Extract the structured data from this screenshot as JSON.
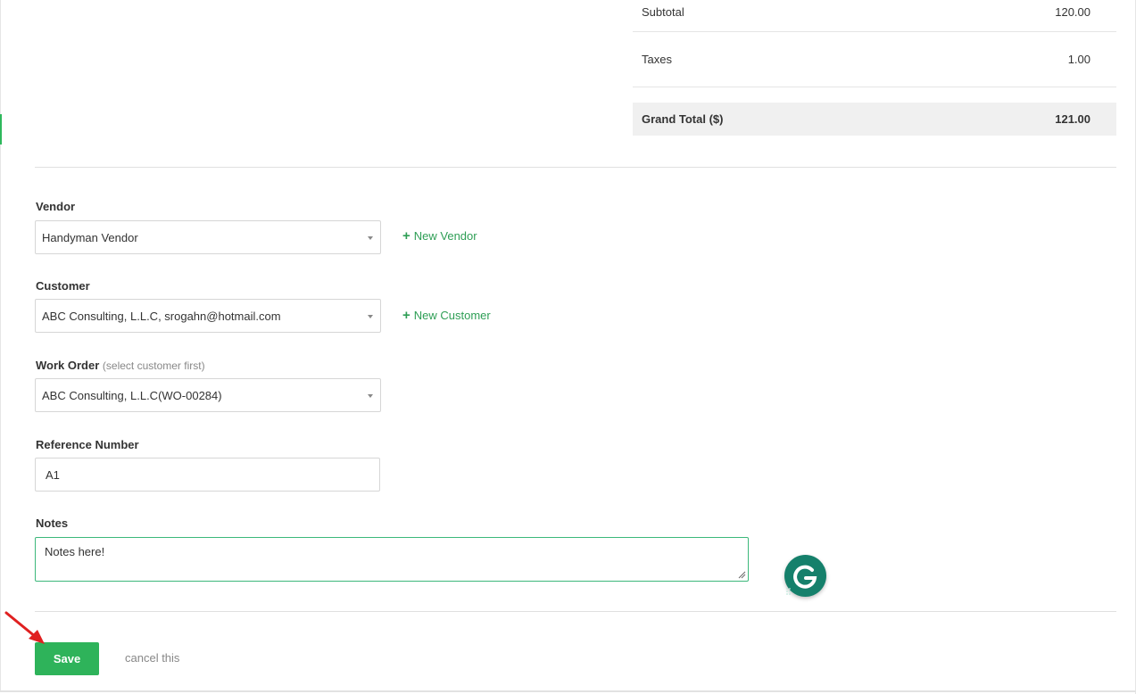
{
  "totals": {
    "subtotal_label": "Subtotal",
    "subtotal_value": "120.00",
    "taxes_label": "Taxes",
    "taxes_value": "1.00",
    "grand_total_label": "Grand Total ($)",
    "grand_total_value": "121.00"
  },
  "form": {
    "vendor": {
      "label": "Vendor",
      "value": "Handyman Vendor",
      "new_link": "New Vendor"
    },
    "customer": {
      "label": "Customer",
      "value": "ABC Consulting, L.L.C, srogahn@hotmail.com",
      "new_link": "New Customer"
    },
    "work_order": {
      "label": "Work Order",
      "hint": "(select customer first)",
      "value": "ABC Consulting, L.L.C(WO-00284)"
    },
    "reference": {
      "label": "Reference Number",
      "value": "A1"
    },
    "notes": {
      "label": "Notes",
      "value": "Notes here!"
    }
  },
  "actions": {
    "save_label": "Save",
    "cancel_label": "cancel this"
  },
  "colors": {
    "accent_green": "#2eb35a",
    "link_green": "#2e9e55",
    "grammarly_teal": "#15806b",
    "annotation_red": "#e02020"
  },
  "icons": {
    "plus": "plus-icon",
    "caret": "chevron-down-icon",
    "grammarly": "grammarly-icon",
    "arrow": "annotation-arrow-icon"
  }
}
